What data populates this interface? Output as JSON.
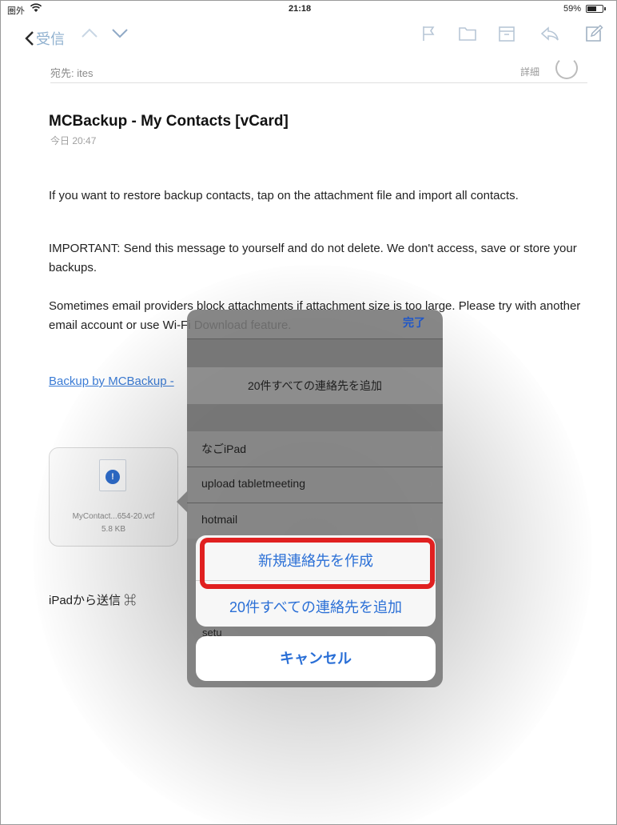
{
  "status_bar": {
    "carrier": "圏外",
    "time": "21:18",
    "battery_percent": "59%",
    "battery_level": 0.59
  },
  "nav": {
    "back_label": "受信"
  },
  "mail": {
    "to_label": "宛先:",
    "to_value": "ites",
    "detail_label": "詳細",
    "subject": "MCBackup - My Contacts [vCard]",
    "date": "今日 20:47",
    "body_1": "If you want to restore backup contacts, tap on the attachment file and import all contacts.",
    "body_2": "IMPORTANT: Send this message to yourself and do not delete. We don't access, save or store your backups.",
    "body_3": "Sometimes email providers block attachments if attachment size is too large. Please try with another email account or use Wi-Fi Download feature.",
    "link": "Backup by MCBackup -",
    "attachment": {
      "filename": "MyContact...654-20.vcf",
      "size": "5.8 KB"
    },
    "signature": "iPadから送信 ⌘"
  },
  "popover": {
    "done_label": "完了",
    "add_all_label": "20件すべての連絡先を追加",
    "rows": [
      "なごiPad",
      "upload tabletmeeting",
      "hotmail"
    ]
  },
  "action_sheet": {
    "create_new": "新規連絡先を作成",
    "add_all": "20件すべての連絡先を追加",
    "peek_row": "setu",
    "cancel": "キャンセル"
  },
  "colors": {
    "accent": "#2a6fd6",
    "highlight": "#e02020"
  }
}
